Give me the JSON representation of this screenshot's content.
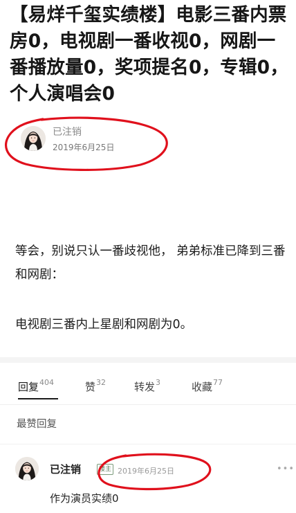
{
  "post": {
    "title": "【易烊千玺实绩楼】电影三番内票房0，电视剧一番收视0，网剧一番播放量0，奖项提名0，专辑0，个人演唱会0",
    "author": {
      "name": "已注销",
      "date": "2019年6月25日"
    },
    "paragraphs": [
      "等会，别说只认一番歧视他， 弟弟标准已降到三番和网剧：",
      "电视剧三番内上星剧和网剧为0。"
    ]
  },
  "tabs": [
    {
      "label": "回复",
      "count": "404",
      "active": true
    },
    {
      "label": "赞",
      "count": "32",
      "active": false
    },
    {
      "label": "转发",
      "count": "3",
      "active": false
    },
    {
      "label": "收藏",
      "count": "77",
      "active": false
    }
  ],
  "replies_section": {
    "heading": "最赞回复",
    "replies": [
      {
        "name": "已注销",
        "badge": "楼主",
        "date": "2019年6月25日",
        "more": "•••",
        "text": "作为演员实绩0"
      }
    ]
  },
  "annotation_color": "#e0101c",
  "icons": {
    "avatar": "user-avatar-photo",
    "more": "more-dots-icon"
  }
}
